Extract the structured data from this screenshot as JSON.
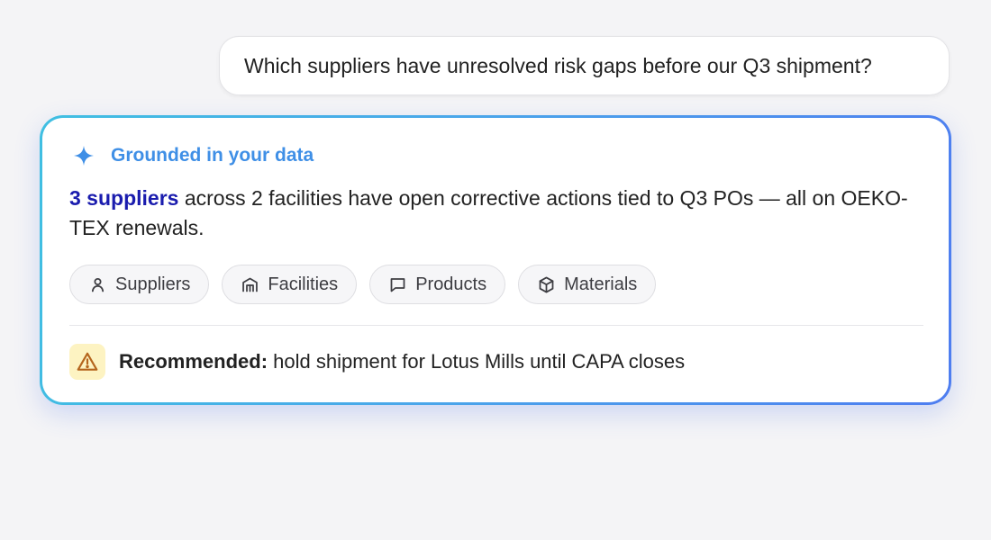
{
  "user_message": {
    "text": "Which suppliers have unresolved risk gaps before our Q3 shipment?"
  },
  "answer": {
    "grounded_label": "Grounded in your data",
    "grounded_icon": "sparkle-icon",
    "summary_highlight": "3 suppliers",
    "summary_rest": " across 2 facilities have open corrective actions tied to Q3 POs — all on OEKO-TEX renewals.",
    "chips": [
      {
        "label": "Suppliers",
        "icon": "person-icon"
      },
      {
        "label": "Facilities",
        "icon": "building-icon"
      },
      {
        "label": "Products",
        "icon": "chat-bubble-icon"
      },
      {
        "label": "Materials",
        "icon": "cube-icon"
      }
    ],
    "recommendation": {
      "icon": "warning-icon",
      "label": "Recommended:",
      "text": " hold shipment for Lotus Mills until CAPA closes"
    }
  },
  "colors": {
    "accent_blue": "#3f8fe6",
    "highlight_navy": "#1a1cae",
    "border_gradient_start": "#40bfe2",
    "border_gradient_end": "#4e7df0",
    "warning_bg": "#fdf3c2",
    "warning_stroke": "#b5651d"
  }
}
